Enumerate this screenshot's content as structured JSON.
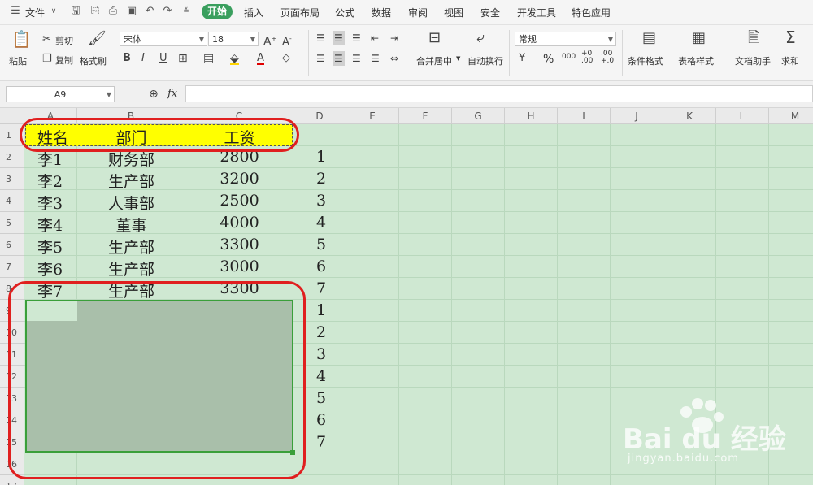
{
  "menubar": {
    "file_label": "文件",
    "tabs": [
      "插入",
      "页面布局",
      "公式",
      "数据",
      "审阅",
      "视图",
      "安全",
      "开发工具",
      "特色应用"
    ],
    "active_tab": "开始"
  },
  "ribbon": {
    "paste": "粘贴",
    "cut": "剪切",
    "copy": "复制",
    "format_painter": "格式刷",
    "font_name": "宋体",
    "font_size": "18",
    "merge_center": "合并居中",
    "wrap_text": "自动换行",
    "number_format": "常规",
    "percent": "%",
    "thousands": "000",
    "dec_inc": "+0\n.00",
    "dec_dec": ".00\n+.0",
    "conditional_format": "条件格式",
    "table_style": "表格样式",
    "doc_assistant": "文档助手",
    "sum": "求和"
  },
  "formula_bar": {
    "name_box": "A9",
    "fx": "fx"
  },
  "sheet": {
    "columns": [
      "A",
      "B",
      "C",
      "D",
      "E",
      "F",
      "G",
      "H",
      "I",
      "J",
      "K",
      "L",
      "M"
    ],
    "rows": [
      "1",
      "2",
      "3",
      "4",
      "5",
      "6",
      "7",
      "8",
      "9",
      "10",
      "11",
      "12",
      "13",
      "14",
      "15",
      "16",
      "17"
    ],
    "header": [
      "姓名",
      "部门",
      "工资"
    ],
    "data": [
      [
        "李1",
        "财务部",
        "2800",
        "1"
      ],
      [
        "李2",
        "生产部",
        "3200",
        "2"
      ],
      [
        "李3",
        "人事部",
        "2500",
        "3"
      ],
      [
        "李4",
        "董事",
        "4000",
        "4"
      ],
      [
        "李5",
        "生产部",
        "3300",
        "5"
      ],
      [
        "李6",
        "生产部",
        "3000",
        "6"
      ],
      [
        "李7",
        "生产部",
        "3300",
        "7"
      ]
    ],
    "d_extra": [
      "1",
      "2",
      "3",
      "4",
      "5",
      "6",
      "7"
    ]
  },
  "watermark": {
    "brand": "Bai du 经验",
    "url": "jingyan.baidu.com"
  },
  "colors": {
    "active_tab": "#3a9f5e",
    "header_fill": "#ffff00",
    "annotation": "#e01f1f",
    "selection_border": "#3a9f3a",
    "grid_bg": "#cfe8d2"
  }
}
